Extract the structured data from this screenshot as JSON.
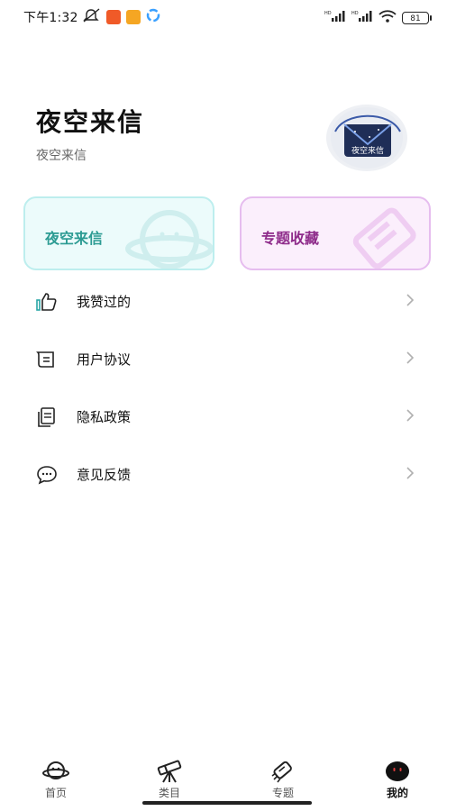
{
  "status_bar": {
    "time": "下午1:32",
    "battery": "81",
    "signal_label_1": "HD",
    "signal_label_2": "HD"
  },
  "profile": {
    "title": "夜空来信",
    "subtitle": "夜空来信",
    "avatar_caption": "夜空来信"
  },
  "cards": {
    "left_label": "夜空来信",
    "right_label": "专题收藏"
  },
  "menu": [
    {
      "label": "我赞过的",
      "icon": "thumbs-up-icon"
    },
    {
      "label": "用户协议",
      "icon": "scroll-icon"
    },
    {
      "label": "隐私政策",
      "icon": "document-icon"
    },
    {
      "label": "意见反馈",
      "icon": "chat-bubble-icon"
    }
  ],
  "bottom_nav": [
    {
      "label": "首页",
      "icon": "planet-icon",
      "active": false
    },
    {
      "label": "类目",
      "icon": "telescope-icon",
      "active": false
    },
    {
      "label": "专题",
      "icon": "rocket-icon",
      "active": false
    },
    {
      "label": "我的",
      "icon": "profile-face-icon",
      "active": true
    }
  ],
  "colors": {
    "left_card_bg": "#ecfbfb",
    "left_card_border": "#bdeeee",
    "left_card_text": "#2c9b93",
    "right_card_bg": "#fbeffc",
    "right_card_border": "#e6bdef",
    "right_card_text": "#8e2b8a"
  }
}
